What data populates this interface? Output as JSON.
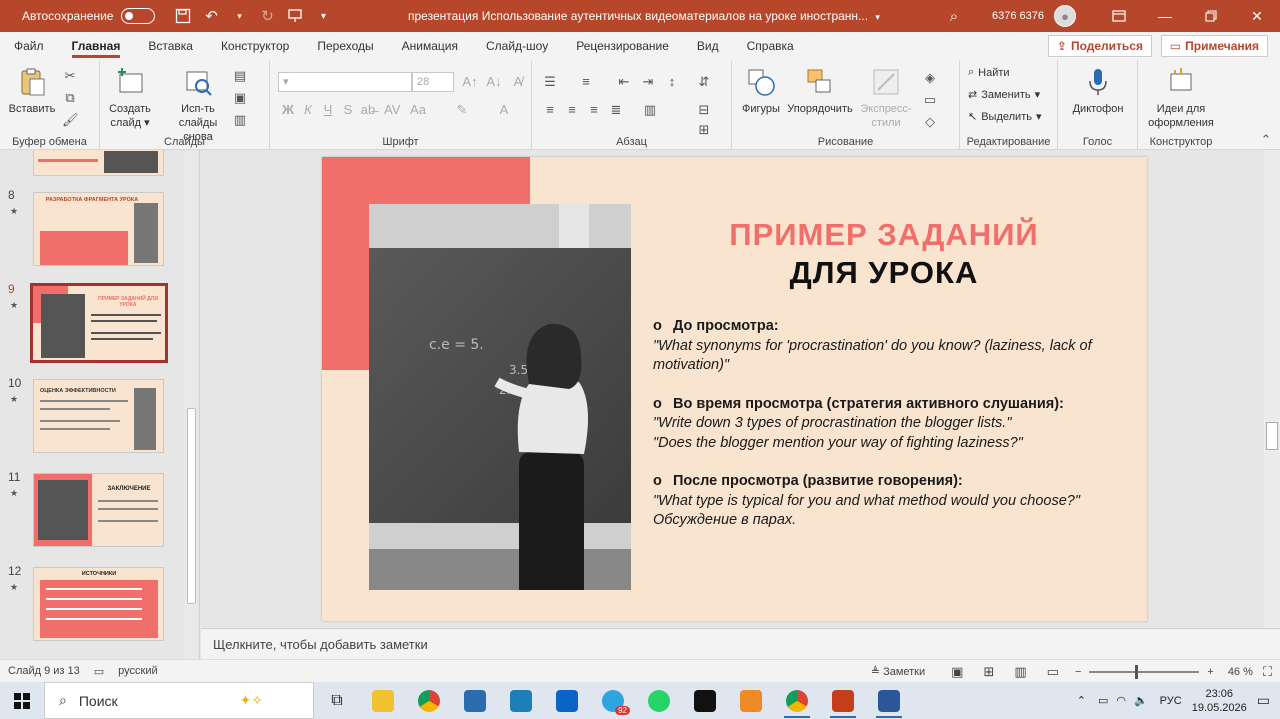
{
  "titlebar": {
    "autosave_label": "Автосохранение",
    "doc_title": "презентация Использование аутентичных видеоматериалов на уроке иностранн...",
    "user_name": "6376 6376"
  },
  "menu": {
    "tabs": [
      "Файл",
      "Главная",
      "Вставка",
      "Конструктор",
      "Переходы",
      "Анимация",
      "Слайд-шоу",
      "Рецензирование",
      "Вид",
      "Справка"
    ],
    "share_label": "Поделиться",
    "comments_label": "Примечания"
  },
  "ribbon": {
    "paste_label": "Вставить",
    "new_slide_label": "Создать слайд",
    "reuse_label": "Исп-ть слайды снова",
    "font_size": "28",
    "shapes_label": "Фигуры",
    "arrange_label": "Упорядочить",
    "quick_styles_label": "Экспресс-стили",
    "find_label": "Найти",
    "replace_label": "Заменить",
    "select_label": "Выделить",
    "dictate_label": "Диктофон",
    "designer_label": "Идеи для оформления",
    "groups": {
      "clipboard": "Буфер обмена",
      "slides": "Слайды",
      "font": "Шрифт",
      "paragraph": "Абзац",
      "drawing": "Рисование",
      "editing": "Редактирование",
      "voice": "Голос",
      "designer": "Конструктор"
    }
  },
  "thumbnails": [
    {
      "num": "8",
      "title": "РАЗРАБОТКА ФРАГМЕНТА УРОКА"
    },
    {
      "num": "9",
      "title": "ПРИМЕР ЗАДАНИЙ ДЛЯ УРОКА",
      "selected": true
    },
    {
      "num": "10",
      "title": "ОЦЕНКА ЭФФЕКТИВНОСТИ"
    },
    {
      "num": "11",
      "title": "ЗАКЛЮЧЕНИЕ"
    },
    {
      "num": "12",
      "title": "ИСТОЧНИКИ"
    }
  ],
  "slide": {
    "title_line1": "ПРИМЕР ЗАДАНИЙ",
    "title_line2": "ДЛЯ УРОКА",
    "bullet_char": "o",
    "before_head": "До просмотра:",
    "before_text": "\"What synonyms for 'procrastination' do you know? (laziness, lack of motivation)\"",
    "during_head": "Во время просмотра (стратегия активного слушания):",
    "during_text1": "\"Write down 3 types of procrastination the blogger lists.\"",
    "during_text2": "\"Does the blogger mention your way of fighting laziness?\"",
    "after_head": "После просмотра (развитие говорения):",
    "after_text1": "\"What type is typical for you and what method would you choose?\"",
    "after_text2": "Обсуждение в парах."
  },
  "notes_placeholder": "Щелкните, чтобы добавить заметки",
  "statusbar": {
    "slide_info": "Слайд 9 из 13",
    "language": "русский",
    "notes_label": "Заметки",
    "zoom": "46 %"
  },
  "taskbar": {
    "search_placeholder": "Поиск",
    "telegram_badge": "92",
    "language": "РУС",
    "time": "23:06",
    "date": "19.05.2026"
  },
  "colors": {
    "accent": "#b7472a",
    "slide_bg": "#f9e4cf",
    "slide_red": "#f06f6a"
  }
}
